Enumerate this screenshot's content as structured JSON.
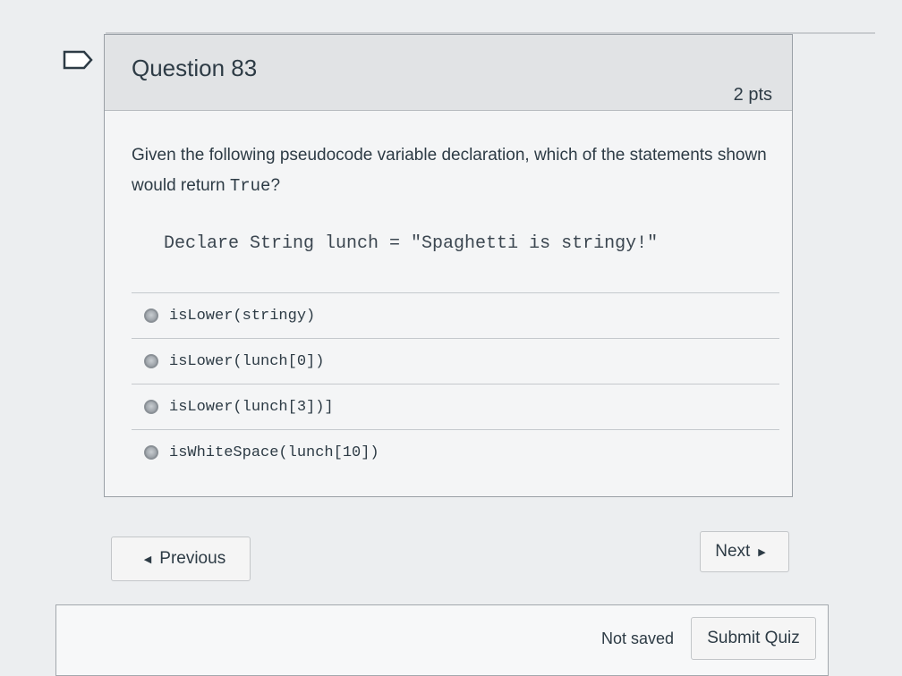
{
  "question": {
    "title": "Question 83",
    "points": "2 pts",
    "prompt_before": "Given the following pseudocode variable declaration, which of the statements shown would return ",
    "prompt_code": "True",
    "prompt_after": "?",
    "declaration": "Declare String lunch = \"Spaghetti is stringy!\"",
    "answers": [
      {
        "label": "isLower(stringy)"
      },
      {
        "label": "isLower(lunch[0])"
      },
      {
        "label": "isLower(lunch[3])]"
      },
      {
        "label": "isWhiteSpace(lunch[10])"
      }
    ]
  },
  "nav": {
    "previous_label": "Previous",
    "next_label": "Next"
  },
  "footer": {
    "status": "Not saved",
    "submit_label": "Submit Quiz"
  },
  "icons": {
    "bookmark": "bookmark-icon",
    "previous": "caret-left-icon",
    "next": "caret-right-icon"
  }
}
